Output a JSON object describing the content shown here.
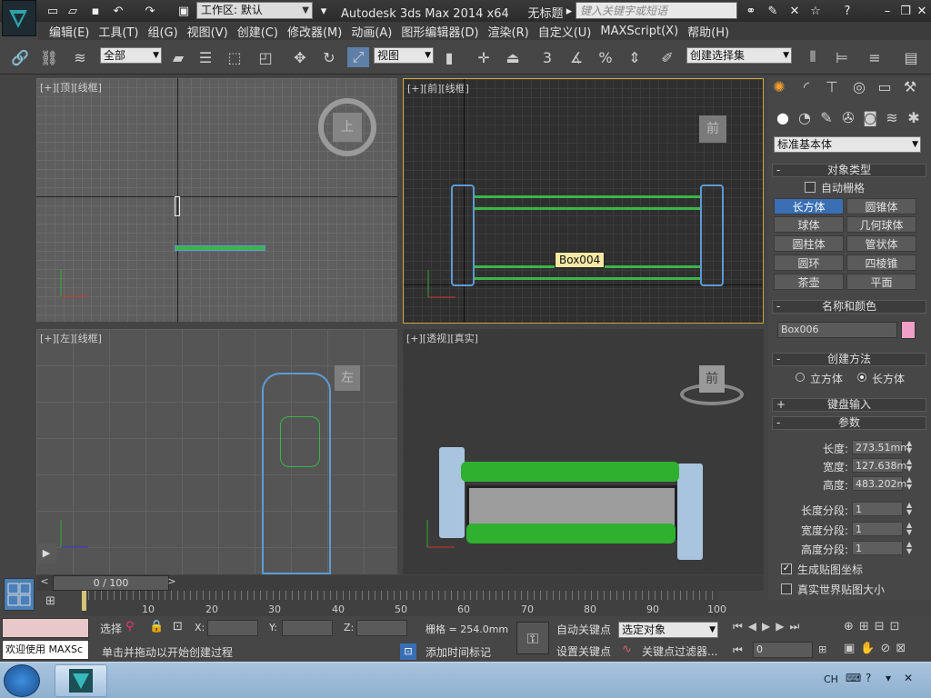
{
  "titlebar": {
    "workspace_label": "工作区: 默认",
    "app_title": "Autodesk 3ds Max  2014 x64",
    "doc_title": "无标题",
    "search_placeholder": "键入关键字或短语"
  },
  "menu": [
    "编辑(E)",
    "工具(T)",
    "组(G)",
    "视图(V)",
    "创建(C)",
    "修改器(M)",
    "动画(A)",
    "图形编辑器(D)",
    "渲染(R)",
    "自定义(U)",
    "MAXScript(X)",
    "帮助(H)"
  ],
  "toolbar": {
    "filter_select": "全部",
    "refcoord_select": "视图",
    "snap_label": "3",
    "selection_set": "创建选择集"
  },
  "viewports": {
    "top": {
      "label": "[+][顶][线框]",
      "cube": "上"
    },
    "front": {
      "label": "[+][前][线框]",
      "cube": "前",
      "tooltip": "Box004"
    },
    "left": {
      "label": "[+][左][线框]",
      "cube": "左"
    },
    "persp": {
      "label": "[+][透视][真实]",
      "cube": "前"
    }
  },
  "command_panel": {
    "category_select": "标准基本体",
    "object_type": {
      "header": "对象类型",
      "autogrid": "自动栅格",
      "buttons": [
        "长方体",
        "圆锥体",
        "球体",
        "几何球体",
        "圆柱体",
        "管状体",
        "圆环",
        "四棱锥",
        "茶壶",
        "平面"
      ]
    },
    "name_color": {
      "header": "名称和颜色",
      "name": "Box006",
      "color": "#f0a0c8"
    },
    "creation_method": {
      "header": "创建方法",
      "opt1": "立方体",
      "opt2": "长方体"
    },
    "keyboard_entry": "键盘输入",
    "parameters": {
      "header": "参数",
      "length_label": "长度:",
      "length": "273.51mm",
      "width_label": "宽度:",
      "width": "127.638m",
      "height_label": "高度:",
      "height": "483.202m",
      "lseg_label": "长度分段:",
      "lseg": "1",
      "wseg_label": "宽度分段:",
      "wseg": "1",
      "hseg_label": "高度分段:",
      "hseg": "1",
      "gen_map": "生成贴图坐标",
      "real_world": "真实世界贴图大小"
    }
  },
  "timeline": {
    "frame": "0 / 100",
    "ticks": [
      "0",
      "10",
      "20",
      "30",
      "40",
      "50",
      "60",
      "70",
      "80",
      "90",
      "100"
    ]
  },
  "status": {
    "welcome": "欢迎使用 MAXSc",
    "select_label": "选择",
    "x_label": "X:",
    "y_label": "Y:",
    "z_label": "Z:",
    "grid": "栅格 = 254.0mm",
    "prompt": "单击并拖动以开始创建过程",
    "add_time_tag": "添加时间标记",
    "auto_key": "自动关键点",
    "set_key": "设置关键点",
    "key_mode_select": "选定对象",
    "key_filters": "关键点过滤器...",
    "frame_field": "0"
  },
  "taskbar": {
    "lang": "CH"
  }
}
